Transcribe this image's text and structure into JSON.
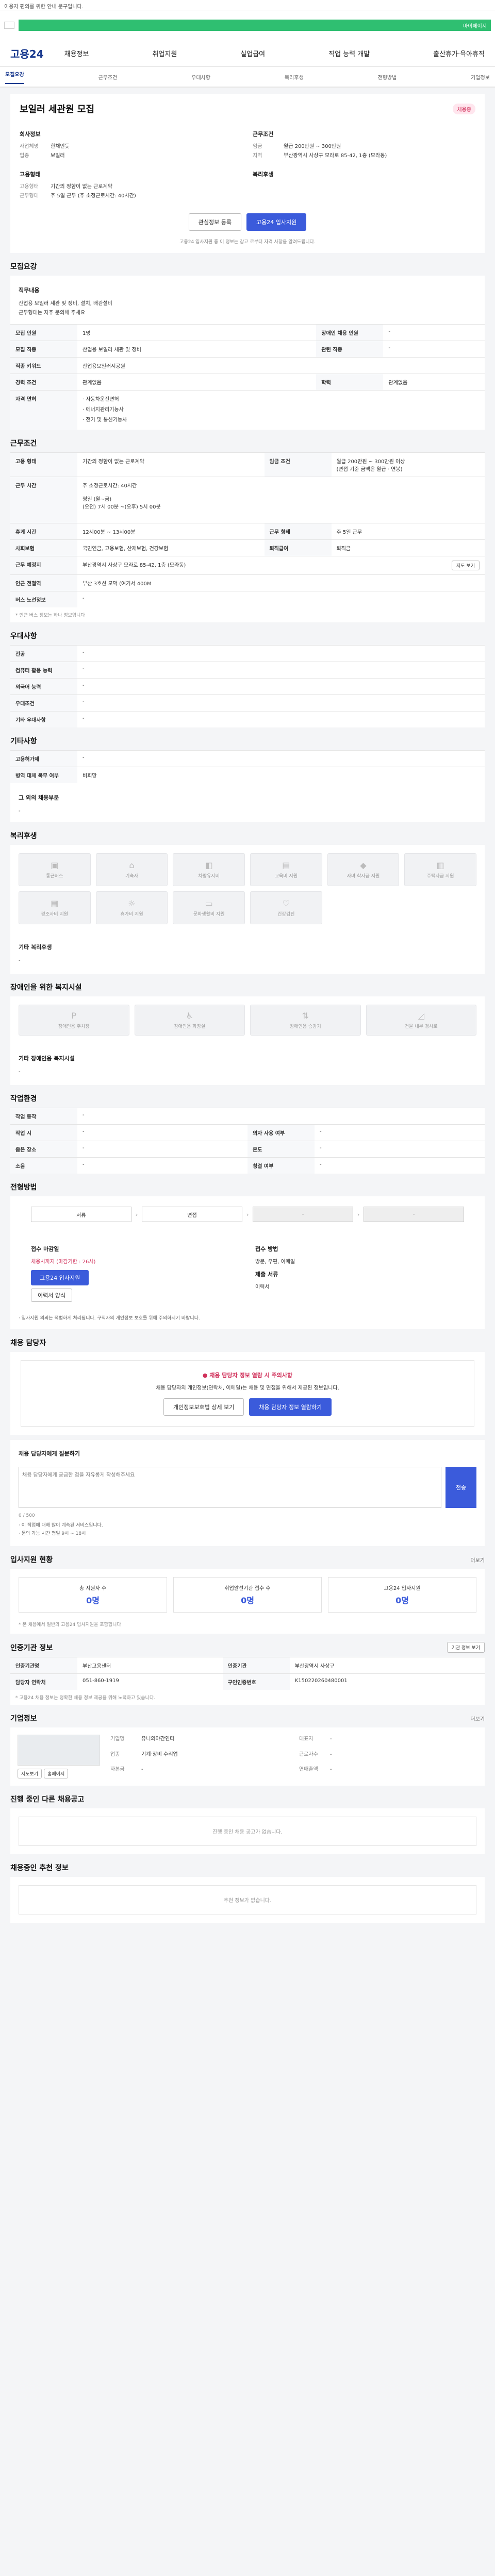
{
  "topbar": {
    "text": "이용자 편의를 위한 안내 문구입니다."
  },
  "gov": {
    "link": "마이페이지"
  },
  "header": {
    "logo": "고용24",
    "menu": [
      "채용정보",
      "취업지원",
      "실업급여",
      "직업 능력 개발",
      "출산휴가·육아휴직"
    ]
  },
  "subnav": [
    "모집요강",
    "근무조건",
    "우대사항",
    "복리후생",
    "전형방법",
    "기업정보"
  ],
  "job": {
    "title": "보일러 세관원 모집",
    "badge": "채용중",
    "company_hdr": "회사정보",
    "company": [
      {
        "k": "사업체명",
        "v": "한채인듯"
      },
      {
        "k": "업종",
        "v": "보일러"
      }
    ],
    "cond_hdr": "근무조건",
    "conds": [
      {
        "k": "임금",
        "v": "월급 200만원 ~ 300만원"
      },
      {
        "k": "지역",
        "v": "부산광역시 사상구 모라로 85-42, 1층 (모라동)"
      }
    ],
    "emp_hdr": "고용형태",
    "emps": [
      {
        "k": "고용형태",
        "v": "기간의 정함이 없는 근로계약"
      },
      {
        "k": "근무형태",
        "v": "주 5일 근무 (주 소정근로시간: 40시간)"
      }
    ],
    "welfare_hdr": "복리후생",
    "btn_interest": "관심정보 등록",
    "btn_apply": "고용24 입사지원",
    "note": "고용24 입사지원 중 이 정보는 참고 로부터 자격 사항을 알려드립니다."
  },
  "recruit": {
    "title": "모집요강",
    "desc_title": "직무내용",
    "desc": "산업용 보일러 세관 및 정비, 설치, 배관설비\n근무형태는 자주 문의해 주세요",
    "rows": [
      [
        "모집 인원",
        "1명",
        "장애인 채용 인원",
        "-"
      ],
      [
        "모집 직종",
        "산업용 보일러 세관 및 정비",
        "관련 직종",
        "-"
      ],
      [
        "직종 키워드",
        "산업용보일러시공원",
        "",
        ""
      ],
      [
        "경력 조건",
        "관계없음",
        "학력",
        "관계없음"
      ],
      [
        "자격 면허",
        "· 자동차운전면허\n· 에너지관리기능사\n· 전기 및 통신기능사",
        "",
        ""
      ]
    ]
  },
  "work": {
    "title": "근무조건",
    "rows": [
      [
        "고용 형태",
        "기간의 정함이 없는 근로계약",
        "임금 조건",
        "월급 200만원 ~ 300만원 이상\n(면접 기준 금액은 월급 · 연봉)"
      ],
      [
        "근무 시간",
        "주 소정근로시간: 40시간\n\n평일 (월~금)\n(오전) 7시 00분 ~(오후) 5시 00분",
        "",
        ""
      ],
      [
        "휴게 시간",
        "12시00분 ~ 13시00분",
        "근무 형태",
        "주 5일 근무"
      ],
      [
        "사회보험",
        "국민연금, 고용보험, 산재보험, 건강보험",
        "퇴직급여",
        "퇴직금"
      ],
      [
        "근무 예정지",
        "부산광역시 사상구 모라로 85-42, 1층 (모라동)",
        "",
        ""
      ],
      [
        "인근 전철역",
        "부산 3호선 모덕 (여기서 400M",
        "",
        ""
      ],
      [
        "버스 노선정보",
        "-",
        "",
        ""
      ]
    ],
    "map_btn": "지도 보기",
    "note": "* 인근 버스 정보는 하나 정보입니다"
  },
  "pref": {
    "title": "우대사항",
    "rows": [
      [
        "전공",
        "-"
      ],
      [
        "컴퓨터 활용 능력",
        "-"
      ],
      [
        "외국어 능력",
        "-"
      ],
      [
        "우대조건",
        "-"
      ],
      [
        "기타 우대사항",
        "-"
      ]
    ]
  },
  "etc": {
    "title": "기타사항",
    "rows": [
      [
        "고용허가제",
        "-"
      ],
      [
        "병역 대체 복무 여부",
        "비희망"
      ]
    ],
    "sub_title": "그 외의 채용부문",
    "sub_val": "-"
  },
  "welfare": {
    "title": "복리후생",
    "items": [
      "통근버스",
      "기숙사",
      "차량유지비",
      "교육비 지원",
      "자녀 학자금 지원",
      "주택자금 지원",
      "경조사비 지원",
      "휴가비 지원",
      "문화생활비 지원",
      "건강검진"
    ],
    "extra_title": "기타 복리후생",
    "extra_val": "-"
  },
  "disability": {
    "title": "장애인을 위한 복지시설",
    "items": [
      "장애인용 주차장",
      "장애인용 화장실",
      "장애인용 승강기",
      "건물 내부 경사로"
    ],
    "extra_title": "기타 장애인용 복지시설",
    "extra_val": "-"
  },
  "workenv": {
    "title": "작업환경",
    "rows": [
      [
        "작업 동작",
        "-",
        "",
        ""
      ],
      [
        "작업 시",
        "-",
        "의자 사용 여부",
        "-"
      ],
      [
        "좁은 장소",
        "-",
        "온도",
        "-"
      ],
      [
        "소음",
        "-",
        "청결 여부",
        "-"
      ]
    ]
  },
  "process": {
    "title": "전형방법",
    "steps": [
      "서류",
      "면접",
      "-",
      "-"
    ],
    "method_hdr": "접수 마감일",
    "method_val": "채용시까지 (마감기한 : 26시)",
    "apply_hdr": "접수 방법",
    "apply_val": "방문, 우편, 이메일",
    "doc_hdr": "제출 서류",
    "doc_val": "이력서",
    "btn_apply": "고용24 입사지원",
    "btn_resume": "이력서 양식",
    "notice": "· 입사지원 의뢰는 적법하게 처리됩니다. 구직자의 개인정보 보호를 위해 주의하시기 바랍니다."
  },
  "contact": {
    "title": "채용 담당자",
    "warn_title": "채용 담당자 정보 열람 시 주의사항",
    "warn_text": "채용 담당자의 개인정보(연락처, 이메일)는 채용 및 면접을 위해서 제공된 정보입니다.",
    "btn_open": "개인정보보호법 상세 보기",
    "btn_view": "채용 담당자 정보 열람하기"
  },
  "inquiry": {
    "title": "채용 담당자에게 질문하기",
    "placeholder": "채용 담당자에게 궁금한 점을 자유롭게 작성해주세요",
    "send": "전송",
    "counter": "0 / 500",
    "notes": [
      "· 이 직업에 대해 많이 계속된 서비스입니다.",
      "· 문의 가능 시간 평일 9시 ~ 18시"
    ]
  },
  "stats": {
    "title": "입사지원 현황",
    "more": "더보기",
    "items": [
      {
        "k": "총 지원자 수",
        "v": "0명"
      },
      {
        "k": "취업알선기관 접수 수",
        "v": "0명"
      },
      {
        "k": "고용24 입사지원",
        "v": "0명"
      }
    ],
    "note": "* 본 채용에서 일반의 고용24 입사지원을 포함합니다"
  },
  "org": {
    "title": "인증기관 정보",
    "btn": "기관 정보 보기",
    "rows": [
      [
        "인증기관명",
        "부산고용센터",
        "인증기관",
        "부산광역시 사상구"
      ],
      [
        "담당자 연락처",
        "051-860-1919",
        "구인인증번호",
        "K150220260480001"
      ]
    ],
    "notes": [
      "* 고용24 채용 정보는 정확한 채용 정보 제공을 위해 노력하고 있습니다."
    ]
  },
  "company": {
    "title": "기업정보",
    "more": "더보기",
    "btn_map": "지도보기",
    "btn_home": "홈페이지",
    "rows": [
      [
        "기업명",
        "유니의야간인터"
      ],
      [
        "업종",
        "기계·장비 수리업"
      ],
      [
        "대표자",
        "-"
      ],
      [
        "근로자수",
        "-"
      ],
      [
        "자본금",
        "-"
      ],
      [
        "연매출액",
        "-"
      ]
    ]
  },
  "others": {
    "title": "진행 중인 다른 채용공고",
    "empty": "진행 중인 채용 공고가 없습니다."
  },
  "similar": {
    "title": "채용중인 추천 정보",
    "empty": "추천 정보가 없습니다."
  }
}
